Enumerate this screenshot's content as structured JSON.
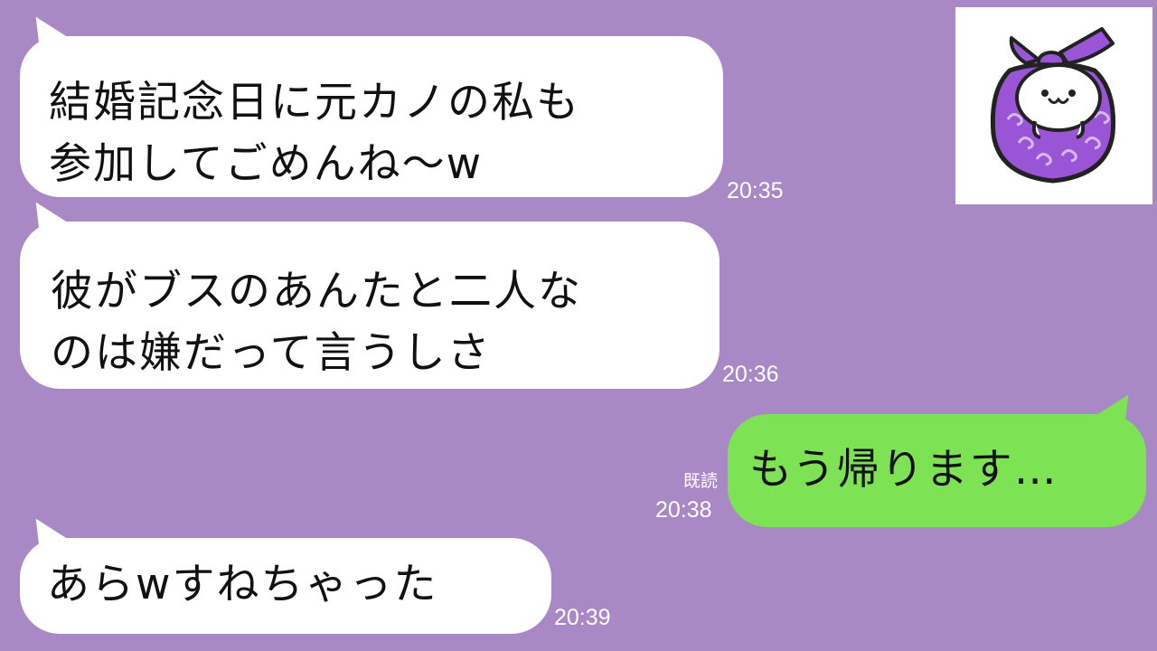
{
  "messages": [
    {
      "side": "in",
      "lines": [
        "結婚記念日に元カノの私も",
        "参加してごめんね～w"
      ],
      "time": "20:35"
    },
    {
      "side": "in",
      "lines": [
        "彼がブスのあんたと二人な",
        "のは嫌だって言うしさ"
      ],
      "time": "20:36"
    },
    {
      "side": "out",
      "lines": [
        "もう帰ります…"
      ],
      "read": "既読",
      "time": "20:38"
    },
    {
      "side": "in",
      "lines": [
        "あらwすねちゃった"
      ],
      "time": "20:39"
    }
  ],
  "sticker": {
    "icon": "purple-bundle-character-icon"
  },
  "colors": {
    "background": "#a889c6",
    "incoming_bubble": "#ffffff",
    "outgoing_bubble": "#7ee354",
    "text": "#111111",
    "meta_text": "#ffffff"
  }
}
